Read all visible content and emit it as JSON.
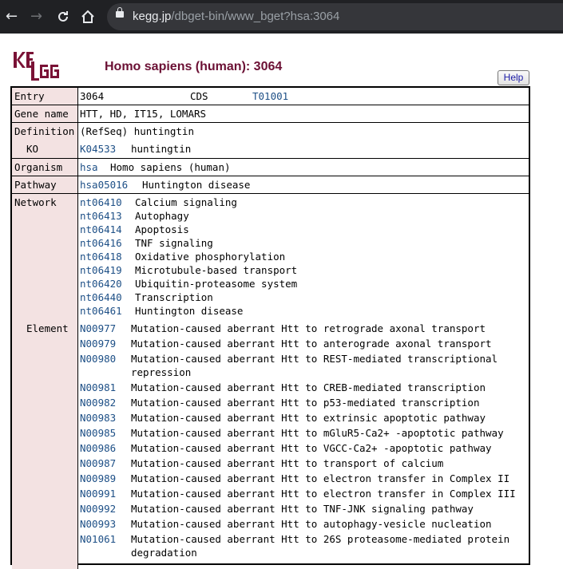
{
  "browser": {
    "url_domain": "kegg.jp",
    "url_path": "/dbget-bin/www_bget?hsa:3064"
  },
  "logo_text": "KEGG",
  "page_title": "Homo sapiens (human): 3064",
  "help_label": "Help",
  "labels": {
    "entry": "Entry",
    "gene_name": "Gene name",
    "definition": "Definition",
    "ko": "KO",
    "organism": "Organism",
    "pathway": "Pathway",
    "network": "Network",
    "element": "Element"
  },
  "entry": {
    "id": "3064",
    "type": "CDS",
    "genome": "T01001"
  },
  "gene_name": "HTT, HD, IT15, LOMARS",
  "definition": "(RefSeq) huntingtin",
  "ko": {
    "id": "K04533",
    "name": "huntingtin"
  },
  "organism": {
    "code": "hsa",
    "name": "Homo sapiens (human)"
  },
  "pathway": {
    "id": "hsa05016",
    "name": "Huntington disease"
  },
  "network": [
    {
      "id": "nt06410",
      "name": "Calcium signaling"
    },
    {
      "id": "nt06413",
      "name": "Autophagy"
    },
    {
      "id": "nt06414",
      "name": "Apoptosis"
    },
    {
      "id": "nt06416",
      "name": "TNF signaling"
    },
    {
      "id": "nt06418",
      "name": "Oxidative phosphorylation"
    },
    {
      "id": "nt06419",
      "name": "Microtubule-based transport"
    },
    {
      "id": "nt06420",
      "name": "Ubiquitin-proteasome system"
    },
    {
      "id": "nt06440",
      "name": "Transcription"
    },
    {
      "id": "nt06461",
      "name": "Huntington disease"
    }
  ],
  "elements": [
    {
      "id": "N00977",
      "lines": [
        "Mutation-caused aberrant Htt to retrograde axonal transport"
      ]
    },
    {
      "id": "N00979",
      "lines": [
        "Mutation-caused aberrant Htt to anterograde axonal transport"
      ]
    },
    {
      "id": "N00980",
      "lines": [
        "Mutation-caused aberrant Htt to REST-mediated transcriptional",
        "repression"
      ]
    },
    {
      "id": "N00981",
      "lines": [
        "Mutation-caused aberrant Htt to CREB-mediated transcription"
      ]
    },
    {
      "id": "N00982",
      "lines": [
        "Mutation-caused aberrant Htt to p53-mediated transcription"
      ]
    },
    {
      "id": "N00983",
      "lines": [
        "Mutation-caused aberrant Htt to extrinsic apoptotic pathway"
      ]
    },
    {
      "id": "N00985",
      "lines": [
        "Mutation-caused aberrant Htt to mGluR5-Ca2+ -apoptotic pathway"
      ]
    },
    {
      "id": "N00986",
      "lines": [
        "Mutation-caused aberrant Htt to VGCC-Ca2+ -apoptotic pathway"
      ]
    },
    {
      "id": "N00987",
      "lines": [
        "Mutation-caused aberrant Htt to transport of calcium"
      ]
    },
    {
      "id": "N00989",
      "lines": [
        "Mutation-caused aberrant Htt to electron transfer in Complex II"
      ]
    },
    {
      "id": "N00991",
      "lines": [
        "Mutation-caused aberrant Htt to electron transfer in Complex III"
      ]
    },
    {
      "id": "N00992",
      "lines": [
        "Mutation-caused aberrant Htt to TNF-JNK signaling pathway"
      ]
    },
    {
      "id": "N00993",
      "lines": [
        "Mutation-caused aberrant Htt to autophagy-vesicle nucleation"
      ]
    },
    {
      "id": "N01061",
      "lines": [
        "Mutation-caused aberrant Htt to 26S proteasome-mediated protein",
        "degradation"
      ]
    }
  ]
}
